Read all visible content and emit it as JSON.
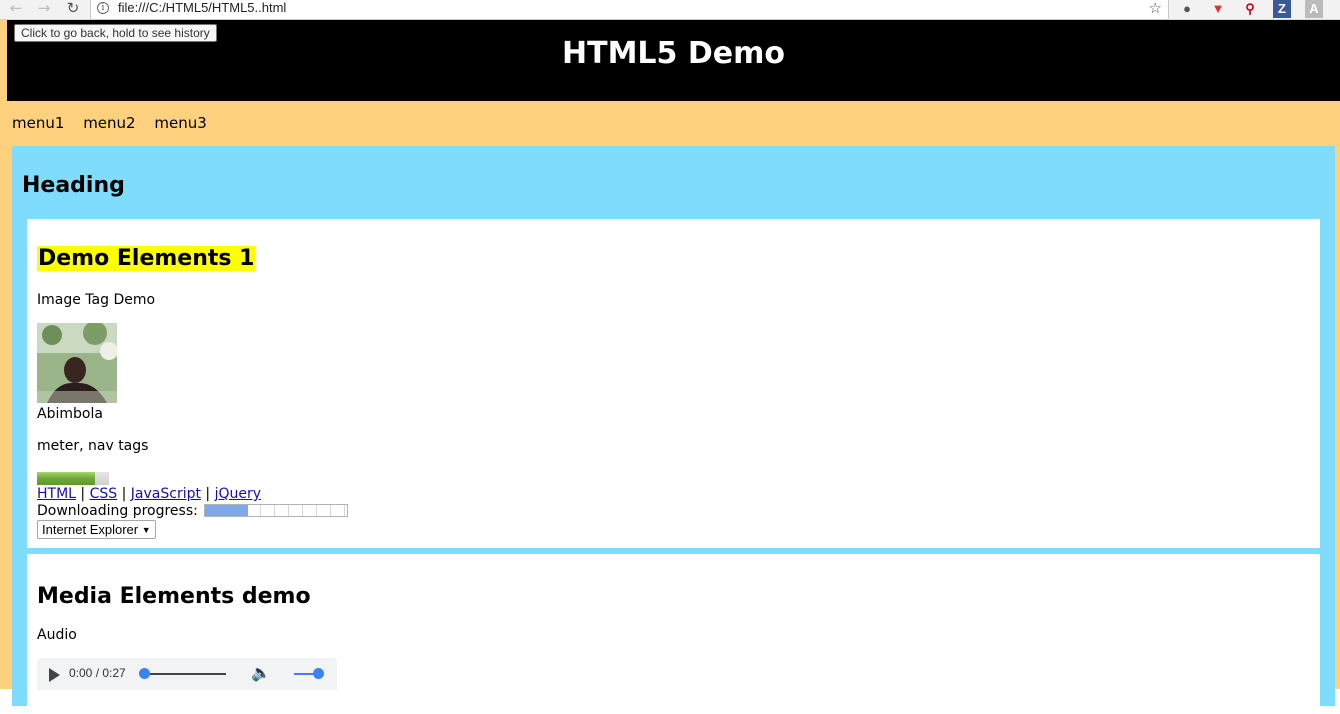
{
  "browser": {
    "url": "file:///C:/HTML5/HTML5..html",
    "tooltip": "Click to go back, hold to see history",
    "extensions": [
      "ghostery-icon",
      "brave-shield-icon",
      "lastpass-icon",
      "zotero-icon",
      "pdf-icon"
    ]
  },
  "header": {
    "title": "HTML5 Demo"
  },
  "menu": {
    "items": [
      "menu1",
      "menu2",
      "menu3"
    ]
  },
  "main": {
    "heading": "Heading",
    "section1": {
      "title": "Demo Elements 1",
      "image_label": "Image Tag Demo",
      "caption": "Abimbola",
      "tags_label": "meter, nav tags",
      "meter_value": 0.8,
      "links": [
        "HTML",
        "CSS",
        "JavaScript",
        "jQuery"
      ],
      "separator": "|",
      "progress_label": "Downloading progress:",
      "progress_value": 0.3,
      "select_value": "Internet Explorer"
    },
    "section2": {
      "title": "Media Elements demo",
      "audio_label": "Audio",
      "audio_time": "0:00 / 0:27"
    }
  },
  "colors": {
    "page_bg": "#fed17f",
    "header_bg": "#000000",
    "main_bg": "#80dcfc",
    "highlight": "#ffff00",
    "link": "#1a0dab"
  }
}
